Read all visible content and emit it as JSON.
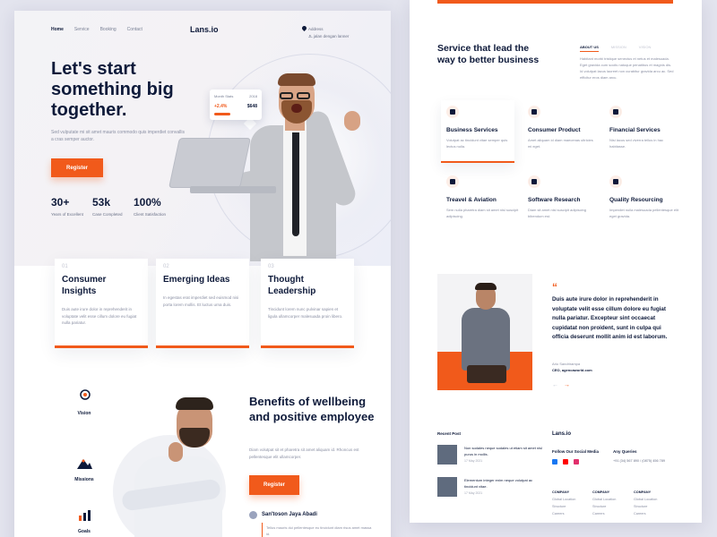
{
  "hero": {
    "nav": [
      "Home",
      "Service",
      "Booking",
      "Contact"
    ],
    "logo": "Lans.io",
    "address_lines": [
      "Address",
      "JL jalan dengan lanner"
    ],
    "title": "Let's start something big together.",
    "subtitle": "Sed vulputate mi sit amet mauris commodo quis imperdiet convallis a cras semper auctor.",
    "cta": "Register",
    "stats": [
      {
        "value": "30+",
        "label": "Years of Excellent"
      },
      {
        "value": "53k",
        "label": "Case Completed"
      },
      {
        "value": "100%",
        "label": "Client Satisfaction"
      }
    ],
    "widget": {
      "label": "Month Stats",
      "year": "2018",
      "change": "+2.4%",
      "amount": "$648"
    }
  },
  "features": [
    {
      "num": "01",
      "title": "Consumer Insights",
      "desc": "Duis aute irure dolor in reprehenderit in voluptate velit esse cillum dolore eu fugiat nulla pariatur."
    },
    {
      "num": "02",
      "title": "Emerging Ideas",
      "desc": "In egestas erat imperdiet sed euismod nisi porta lorem mollis. Et luctus urna duis."
    },
    {
      "num": "03",
      "title": "Thought Leadership",
      "desc": "Tincidunt lorem nunc pulvinar sapien et ligula ullamcorper malesuada proin libero."
    }
  ],
  "values": [
    "Vision",
    "Missions",
    "Goals"
  ],
  "benefits": {
    "title": "Benefits of wellbeing and positive employee",
    "subtitle": "Diam volutpat sit et pharetra sit amet aliquam id. Rhoncus est pellentesque elit ullamcorper.",
    "cta": "Register",
    "author": "San'toson Jaya Abadi",
    "author_text": "Tellus mauris dui pellentesque eu tincidunt diam risus amet massa id."
  },
  "services": {
    "title": "Service that lead the way to better business",
    "tabs": [
      "ABOUT US",
      "MISSION",
      "VISION"
    ],
    "tab_text": "Habitant morbi tristique senectus et netus et malesuada. Eget gravida cum sociis natoque penatibus et magnis dis. Id volutpat lacus laoreet non curabitur gravida arcu ac. Sed efficitur eros diam arcu.",
    "items": [
      {
        "title": "Business Services",
        "desc": "Volutpat ac tincidunt vitae semper quis lectus nulla."
      },
      {
        "title": "Consumer Product",
        "desc": "Amet aliquam id diam maecenas ultricies mi eget."
      },
      {
        "title": "Financial Services",
        "desc": "Nisi lacus sed viverra tellus in hac habitasse."
      },
      {
        "title": "Treavel & Aviation",
        "desc": "Sem nulla pharetra diam sit amet nisl suscipit adipiscing."
      },
      {
        "title": "Software Research",
        "desc": "Diam sit amet nisl suscipit adipiscing bibendum est."
      },
      {
        "title": "Quality Resourcing",
        "desc": "Imperdiet nulla malesuada pellentesque elit eget gravida."
      }
    ]
  },
  "testimonial": {
    "quote": "Duis aute irure dolor in reprehenderit in voluptate velit esse cillum dolore eu fugiat nulla pariatur. Excepteur sint occaecat cupidatat non proident, sunt in culpa qui officia deserunt mollit anim id est laborum.",
    "name": "Ario Sandrirampa",
    "role": "CEO, agencaworld.com",
    "prev": "←",
    "next": "→"
  },
  "footer": {
    "recent_post": "Recent Post",
    "posts": [
      {
        "text": "Non sodales neque sodales ut etiam sit amet nisl purus in mollis.",
        "date": "17 May 2021"
      },
      {
        "text": "Elementum integer enim neque volutpat ac tincidunt vitae.",
        "date": "17 May 2021"
      }
    ],
    "logo": "Lans.io",
    "follow": "Follow Our Social Media",
    "queries": "Any Queries",
    "phone": "+91 (34) 567 890 / (0875) 456 789",
    "columns": [
      {
        "head": "COMPANY",
        "links": [
          "Global Location",
          "Structure",
          "Careers"
        ]
      },
      {
        "head": "COMPANY",
        "links": [
          "Global Location",
          "Structure",
          "Careers"
        ]
      },
      {
        "head": "COMPANY",
        "links": [
          "Global Location",
          "Structure",
          "Careers"
        ]
      }
    ],
    "social_colors": [
      "#1877f2",
      "#ff0000",
      "#e1306c"
    ]
  },
  "colors": {
    "accent": "#f15a1b",
    "navy": "#0e1a3a"
  }
}
